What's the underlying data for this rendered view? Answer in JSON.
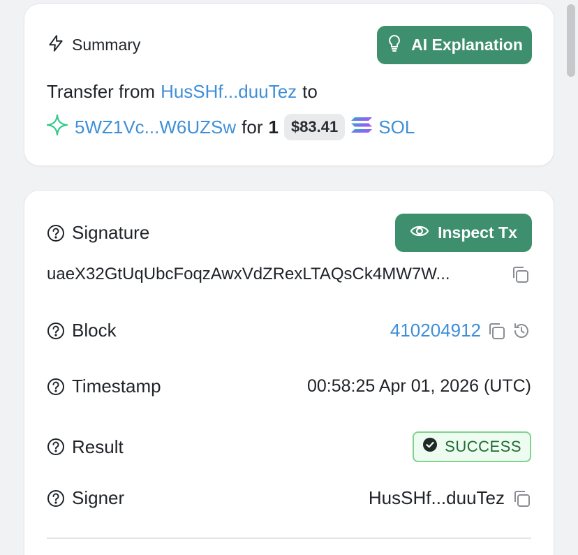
{
  "summary": {
    "title": "Summary",
    "ai_button_label": "AI Explanation",
    "transfer_prefix": "Transfer from",
    "from_address": "HusSHf...duuTez",
    "to_word": "to",
    "to_address": "5WZ1Vc...W6UZSw",
    "for_word": "for",
    "amount": "1",
    "usd_value": "$83.41",
    "token": "SOL"
  },
  "details": {
    "inspect_button_label": "Inspect Tx",
    "signature": {
      "label": "Signature",
      "value": "uaeX32GtUqUbcFoqzAwxVdZRexLTAQsCk4MW7W..."
    },
    "block": {
      "label": "Block",
      "value": "410204912"
    },
    "timestamp": {
      "label": "Timestamp",
      "value": "00:58:25 Apr 01, 2026 (UTC)"
    },
    "result": {
      "label": "Result",
      "value": "SUCCESS"
    },
    "signer": {
      "label": "Signer",
      "value": "HusSHf...duuTez"
    }
  },
  "colors": {
    "accent_green": "#3d8f6e",
    "link_blue": "#3f8fd8",
    "success_border": "#7fd38d",
    "success_text": "#1f6b34"
  },
  "icons": {
    "summary": "lightning-icon",
    "ai": "lightbulb-icon",
    "inspect": "eye-icon",
    "help": "help-circle-icon",
    "copy": "copy-icon",
    "history": "history-icon",
    "success": "check-circle-icon",
    "token": "solana-logo"
  }
}
